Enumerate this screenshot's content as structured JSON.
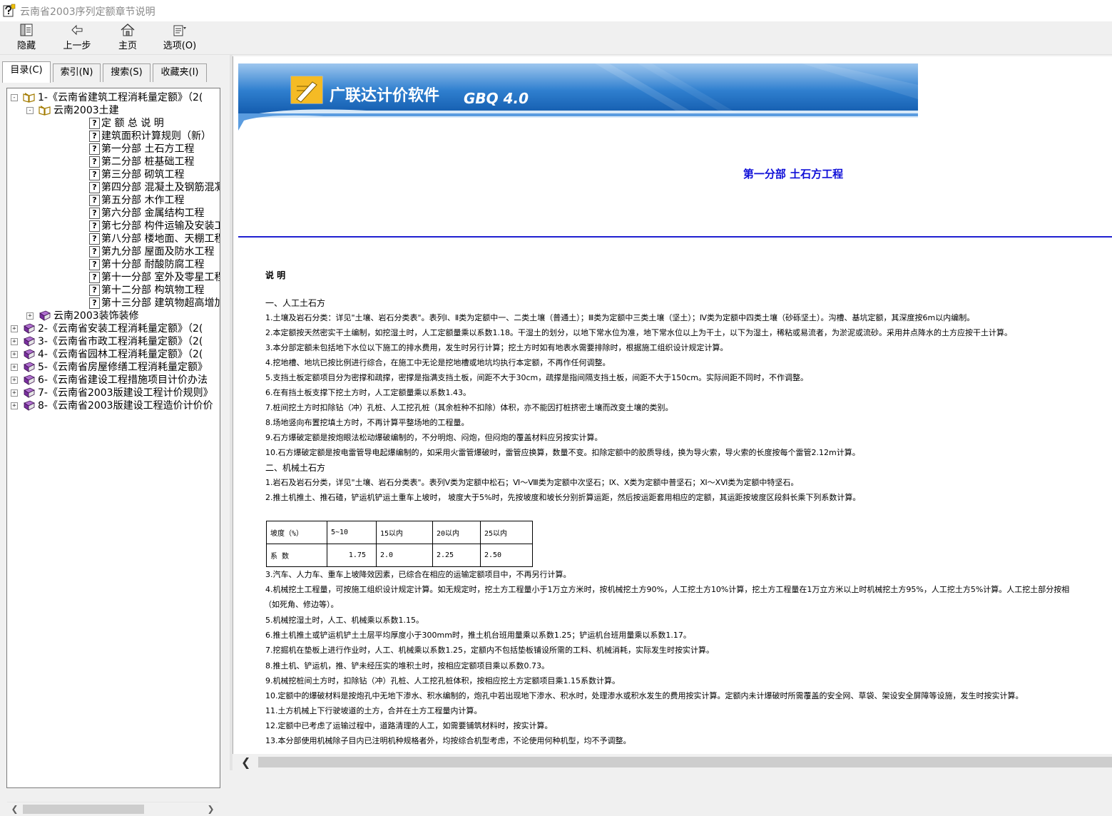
{
  "window": {
    "title": "云南省2003序列定额章节说明"
  },
  "toolbar": {
    "buttons": [
      {
        "label": "隐藏",
        "icon": "hide-icon"
      },
      {
        "label": "上一步",
        "icon": "back-arrow-icon"
      },
      {
        "label": "主页",
        "icon": "home-icon"
      },
      {
        "label": "选项(O)",
        "icon": "options-icon"
      }
    ]
  },
  "tabs": [
    "目录(C)",
    "索引(N)",
    "搜索(S)",
    "收藏夹(I)"
  ],
  "tree": {
    "items": [
      {
        "label": "1-《云南省建筑工程消耗量定额》（2(",
        "exp": "-",
        "icon": "book-open"
      },
      {
        "label": "云南2003土建",
        "exp": "-",
        "icon": "book-open"
      },
      {
        "label": "定 额 总 说 明",
        "icon": "help-page"
      },
      {
        "label": "建筑面积计算规则（新）",
        "icon": "help-page"
      },
      {
        "label": "第一分部 土石方工程",
        "icon": "help-page"
      },
      {
        "label": "第二分部 桩基础工程",
        "icon": "help-page"
      },
      {
        "label": "第三分部 砌筑工程",
        "icon": "help-page"
      },
      {
        "label": "第四分部 混凝土及钢筋混凝土",
        "icon": "help-page"
      },
      {
        "label": "第五分部 木作工程",
        "icon": "help-page"
      },
      {
        "label": "第六分部 金属结构工程",
        "icon": "help-page"
      },
      {
        "label": "第七分部 构件运输及安装工程",
        "icon": "help-page"
      },
      {
        "label": "第八分部 楼地面、天棚工程",
        "icon": "help-page"
      },
      {
        "label": "第九分部 屋面及防水工程",
        "icon": "help-page"
      },
      {
        "label": "第十分部 耐酸防腐工程",
        "icon": "help-page"
      },
      {
        "label": "第十一分部 室外及零星工程",
        "icon": "help-page"
      },
      {
        "label": "第十二分部 构筑物工程",
        "icon": "help-page"
      },
      {
        "label": "第十三分部 建筑物超高增加费",
        "icon": "help-page"
      },
      {
        "label": "云南2003装饰装修",
        "exp": "+",
        "icon": "book-closed"
      },
      {
        "label": "2-《云南省安装工程消耗量定额》（2(",
        "exp": "+",
        "icon": "book-closed"
      },
      {
        "label": "3-《云南省市政工程消耗量定额》（2(",
        "exp": "+",
        "icon": "book-closed"
      },
      {
        "label": "4-《云南省园林工程消耗量定额》（2(",
        "exp": "+",
        "icon": "book-closed"
      },
      {
        "label": "5-《云南省房屋修缮工程消耗量定额》",
        "exp": "+",
        "icon": "book-closed"
      },
      {
        "label": "6-《云南省建设工程措施项目计价办法",
        "exp": "+",
        "icon": "book-closed"
      },
      {
        "label": "7-《云南省2003版建设工程计价规则》",
        "exp": "+",
        "icon": "book-closed"
      },
      {
        "label": "8-《云南省2003版建设工程造价计价价",
        "exp": "+",
        "icon": "book-closed"
      }
    ]
  },
  "banner": {
    "text": "广联达计价软件",
    "version": "GBQ 4.0"
  },
  "content": {
    "heading": "第一分部 土石方工程",
    "section_title": "说 明",
    "lines_a": [
      "一、人工土石方",
      "1.土壤及岩石分类：详见\"土壤、岩石分类表\"。表列Ⅰ、Ⅱ类为定额中一、二类土壤（普通土）；Ⅲ类为定额中三类土壤（坚土）；Ⅳ类为定额中四类土壤（砂砾坚土）。沟槽、基坑定额，其深度按6m以内编制。",
      "2.本定额按天然密实干土编制，如挖湿土时，人工定额量乘以系数1.18。干湿土的划分，以地下常水位为准，地下常水位以上为干土，以下为湿土，稀粘或易流者，为淤泥或流砂。采用井点降水的土方应按干土计算。",
      "3.本分部定额未包括地下水位以下施工的排水费用，发生时另行计算；挖土方时如有地表水需要排除时，根据施工组织设计规定计算。",
      "4.挖地槽、地坑已按比例进行综合，在施工中无论是挖地槽或地坑均执行本定额，不再作任何调整。",
      "5.支挡土板定额项目分为密撑和疏撑，密撑是指满支挡土板，间距不大于30cm，疏撑是指间隔支挡土板，间距不大于150cm。实际间距不同时，不作调整。",
      "6.在有挡土板支撑下挖土方时，人工定额量乘以系数1.43。",
      "7.桩间挖土方时扣除钻（冲）孔桩、人工挖孔桩（其余桩种不扣除）体积，亦不能因打桩挤密土壤而改变土壤的类别。",
      "8.场地竖向布置挖填土方时，不再计算平整场地的工程量。",
      "9.石方爆破定额是按炮眼法松动爆破编制的，不分明炮、闷炮，但闷炮的覆盖材料应另按实计算。",
      "10.石方爆破定额是按电雷管导电起爆编制的，如采用火雷管爆破时，雷管应换算，数量不变。扣除定额中的胶质导线，换为导火索，导火索的长度按每个雷管2.12m计算。",
      "二、机械土石方",
      "1.岩石及岩石分类，详见\"土壤、岩石分类表\"。表列Ⅴ类为定额中松石；Ⅵ～Ⅷ类为定额中次坚石；Ⅸ、Ⅹ类为定额中普坚石；Ⅺ～ⅩⅥ类为定额中特坚石。",
      "2.推土机推土、推石碴，铲运机铲运土重车上坡时， 坡度大于5%时，先按坡度和坡长分别折算运距，然后按运距套用相应的定额，其运距按坡度区段斜长乘下列系数计算。"
    ],
    "table": {
      "header": [
        "坡度（%）",
        "5~10",
        "15以内",
        "20以内",
        "25以内"
      ],
      "row": [
        "系 数",
        "1.75",
        "2.0",
        "2.25",
        "2.50"
      ]
    },
    "lines_b": [
      "3.汽车、人力车、重车上坡降效因素，已综合在相应的运输定额项目中，不再另行计算。",
      "4.机械挖土工程量，可按施工组织设计规定计算。如无规定时，挖土方工程量小于1万立方米时，按机械挖土方90%，人工挖土方10%计算，挖土方工程量在1万立方米以上时机械挖土方95%，人工挖土方5%计算。人工挖土部分按相",
      "（如死角、修边等）。",
      "5.机械挖湿土时，人工、机械乘以系数1.15。",
      "6.推土机推土或铲运机铲土土层平均厚度小于300mm时，推土机台班用量乘以系数1.25；铲运机台班用量乘以系数1.17。",
      "7.挖掘机在垫板上进行作业时，人工、机械乘以系数1.25，定额内不包括垫板铺设所需的工料、机械消耗，实际发生时按实计算。",
      "8.推土机、铲运机，推、铲未经压实的堆积土时，按相应定额项目乘以系数0.73。",
      "9.机械挖桩间土方时，扣除钻（冲）孔桩、人工挖孔桩体积，按相应挖土方定额项目乘1.15系数计算。",
      "10.定额中的爆破材料是按炮孔中无地下渗水、积水编制的，炮孔中若出现地下渗水、积水时，处理渗水或积水发生的费用按实计算。定额内未计爆破时所需覆盖的安全网、草袋、架设安全屏障等设施，发生时按实计算。",
      "11.土方机械上下行驶坡道的土方，合并在土方工程量内计算。",
      "12.定额中已考虑了运输过程中，道路清理的人工，如需要铺筑材料时，按实计算。",
      "13.本分部使用机械除子目内已注明机种规格者外，均按综合机型考虑，不论使用何种机型，均不予调整。"
    ]
  }
}
